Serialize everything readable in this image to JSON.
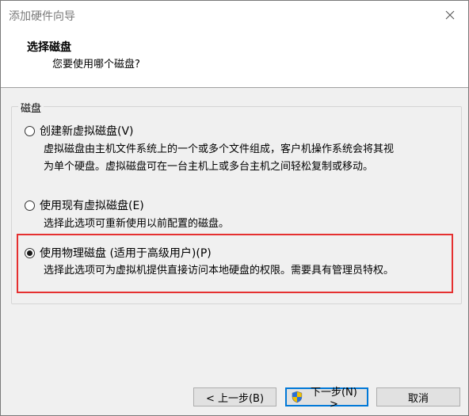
{
  "window": {
    "title": "添加硬件向导"
  },
  "header": {
    "title": "选择磁盘",
    "subtitle": "您要使用哪个磁盘?"
  },
  "group": {
    "label": "磁盘",
    "options": [
      {
        "label": "创建新虚拟磁盘(V)",
        "selected": false,
        "description_lines": [
          "虚拟磁盘由主机文件系统上的一个或多个文件组成，客户机操作系统会将其视",
          "为单个硬盘。虚拟磁盘可在一台主机上或多台主机之间轻松复制或移动。"
        ]
      },
      {
        "label": "使用现有虚拟磁盘(E)",
        "selected": false,
        "description_lines": [
          "选择此选项可重新使用以前配置的磁盘。"
        ]
      },
      {
        "label": "使用物理磁盘 (适用于高级用户)(P)",
        "selected": true,
        "description_lines": [
          "选择此选项可为虚拟机提供直接访问本地硬盘的权限。需要具有管理员特权。"
        ]
      }
    ]
  },
  "buttons": {
    "back": "< 上一步(B)",
    "next": "下一步(N) >",
    "cancel": "取消"
  },
  "colors": {
    "highlight": "#e53030",
    "dialog_bg": "#f0f0f0",
    "default_button_border": "#0078d7"
  }
}
